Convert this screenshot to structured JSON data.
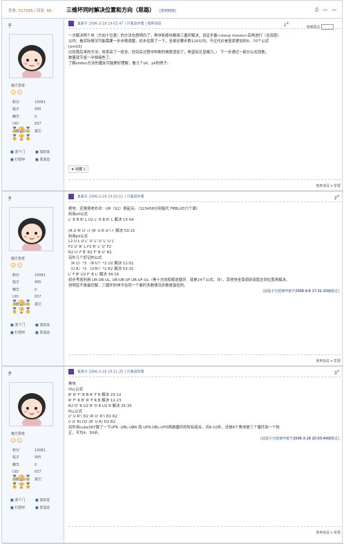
{
  "header": {
    "views_label": "查看:",
    "views": "517165",
    "replies_label": "回复:",
    "replies": "66",
    "title": "三维坏同时解决位置和方向（思路）",
    "tag": "[复制链接]",
    "tools": "⎙ ▭ ▭"
  },
  "posts": [
    {
      "username": "子",
      "rank": "魔方勇者",
      "info": [
        [
          "积分",
          "10081"
        ],
        [
          "帖子",
          "995"
        ],
        [
          "精华",
          "0"
        ],
        [
          "UID",
          "837"
        ],
        [
          "兴趣爱好",
          "其它"
        ]
      ],
      "actions": [
        "发个门",
        "加好友",
        "打招呼",
        "发消息"
      ],
      "meta": "发表于 2006-3-18 19:02:47",
      "meta_extra": "只看该作者 | 倒序浏览",
      "floor": "1",
      "floor_sup": "#",
      "jump_label": "电梯直达",
      "lines": [
        "一次解决两个块（方向十位置）的方法也想明白了。角块和棱块都用三循环解决，设定步番<steup moves>后再进行（含双层）",
        "以内。看实际情况可能需要一步步微调整。初步估算了一下，全部还要步数120以内。不过代价是复原更加的6、70个公式",
        "[em03]",
        "比较我后来的方法，效率高了一倍多。但目后过程中判断的难度增加了，希望有见显赐力。）  下一步通过一部分公式改数，",
        "数量就节省一半相接些了。",
        "了解stefen方法的魔友可能更好理解，看几个oll、pll的例子。"
      ],
      "fav_label": "收藏 1",
      "footer": "使用道具 ▾   举报"
    },
    {
      "username": "子",
      "rank": "魔方勇者",
      "info": [
        [
          "积分",
          "10081"
        ],
        [
          "帖子",
          "995"
        ],
        [
          "精华",
          "0"
        ],
        [
          "UID",
          "837"
        ],
        [
          "兴趣爱好",
          "其它"
        ]
      ],
      "actions": [
        "发个门",
        "加好友",
        "打招呼",
        "发消息"
      ],
      "meta": "发表于 2006-3-18 19:10:51",
      "meta_extra": "只看该作者",
      "floor": "2",
      "floor_sup": "#",
      "lines": [
        "棱块、还是按老办法：UR（S2）是起点。（123456分别指代 FRBLUD六个面）",
        "利用oll公式",
        "L' R B R' L U2 L' R B R' L    解决 15-54",
        "",
        "(R U R' U' r) (R' U R U') r'    解决  53-15",
        "利用pll公式",
        "L2 U L U L' U' L' U' L' U L'",
        "F2 U' R' L F2 R' L' U' F2",
        "R2 U' F B' R2 F' B U' R2",
        "另外几个好记的公式",
        "（R U）*3 （R'U'）*2 U2   解决 12-51",
        "（U R）*3 （U'R'）*2 R2   解决 53-32",
        "  L' F B' U2 F' B L'      解决  34-14",
        "初步考虑利用 UR-UB-UL, UR-UB-UF,UR-UF-UL（骨十方向和棱逆循环、就是24个公式。许），其他块全靠调到该层达到位置来解决。",
        "但明显不是最优解，三循环的块不在同一个面时多数情况步数是最佳的。"
      ],
      "edit_note": "[此贴子已经被作者于",
      "edit_time": "2006-9-8 17:31:20",
      "edit_suffix": "编辑过]",
      "footer": "使用道具 ▾   举报"
    },
    {
      "username": "子",
      "rank": "魔方勇者",
      "info": [
        [
          "积分",
          "10081"
        ],
        [
          "帖子",
          "995"
        ],
        [
          "精华",
          "0"
        ],
        [
          "UID",
          "837"
        ],
        [
          "兴趣爱好",
          "其它"
        ]
      ],
      "actions": [
        "发个门",
        "加好友",
        "打招呼",
        "发消息"
      ],
      "meta": "发表于 2006-3-18 19:11:25",
      "meta_extra": "只看该作者",
      "floor": "3",
      "floor_sup": "#",
      "lines": [
        "角块",
        "OLL公式",
        "B' R' F' R B R' F R 解决 23-12",
        "R' F' R B' R' F R B 解决 12-23",
        "R2 D' R U2 R' D R U2 R 解决  25-35",
        "PLL公式",
        "(l' U R') D2 (R U' R') D2 R2",
        "(l U' R) D2 (R' U R) D2 R2",
        "另外用cube367算了一下UFR -UBL-UBR 和 UFR-UBL-UFD两面循环的所有组合，共8-10步，还是8个角块是三个循环加一个校",
        "正，平均4、50步。"
      ],
      "edit_note": "[此贴子已经被作者于",
      "edit_time": "2006-3-18 20:03:49",
      "edit_suffix": "编辑过]",
      "footer": "使用道具 ▾   举报"
    }
  ],
  "colors": {
    "accent": "#3b69a5",
    "border": "#c9d4e0",
    "sidebar": "#f4f7fb",
    "count": "#e05a00"
  }
}
